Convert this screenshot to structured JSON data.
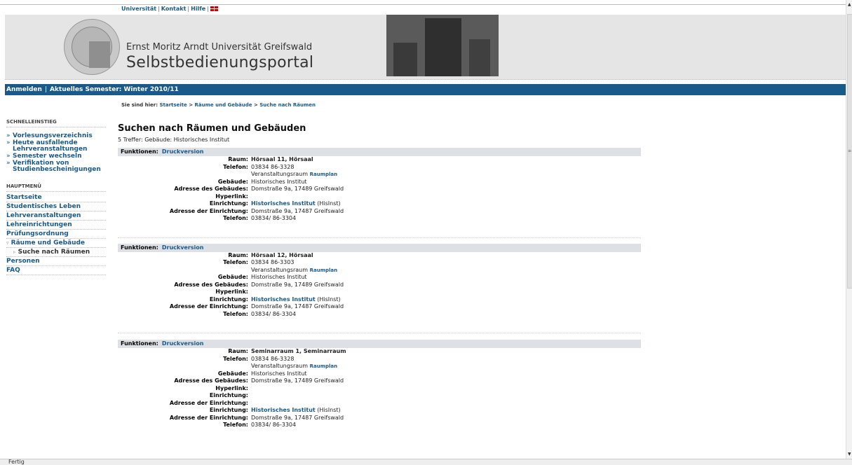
{
  "toplinks": {
    "universitaet": "Universität",
    "kontakt": "Kontakt",
    "hilfe": "Hilfe",
    "sep": "|"
  },
  "header": {
    "university": "Ernst Moritz Arndt Universität Greifswald",
    "portal": "Selbstbedienungsportal"
  },
  "navbar": {
    "login": "Anmelden",
    "semester": "Aktuelles Semester: Winter 2010/11",
    "sep": "|"
  },
  "breadcrumb": {
    "prefix": "Sie sind hier:",
    "crumbs": [
      "Startseite",
      "Räume und Gebäude",
      "Suche nach Räumen"
    ],
    "sep": ">"
  },
  "sidebar": {
    "quick_head": "SCHNELLEINSTIEG",
    "quick": [
      "Vorlesungsverzeichnis",
      "Heute ausfallende Lehrveranstaltungen",
      "Semester wechseln",
      "Verifikation von Studienbescheinigungen"
    ],
    "main_head": "HAUPTMENÜ",
    "main": [
      "Startseite",
      "Studentisches Leben",
      "Lehrveranstaltungen",
      "Lehreinrichtungen",
      "Prüfungsordnung",
      "Räume und Gebäude",
      "Suche nach Räumen",
      "Personen",
      "FAQ"
    ],
    "main_active_marker": "▿",
    "sub_marker": "▹"
  },
  "content": {
    "title": "Suchen nach Räumen und Gebäuden",
    "hits": "5 Treffer: Gebäude: Historisches Institut",
    "func_label": "Funktionen:",
    "func_link": "Druckversion",
    "results": [
      {
        "raum_label": "Raum:",
        "raum": "Hörsaal 11, Hörsaal",
        "telefon_label": "Telefon:",
        "telefon": "03834 86-3328",
        "veranstaltung": "Veranstaltungsraum",
        "raumplan": "Raumplan",
        "gebaeude_label": "Gebäude:",
        "gebaeude": "Historisches Institut",
        "adresse_label": "Adresse des Gebäudes:",
        "adresse": "Domstraße 9a, 17489 Greifswald",
        "hyperlink_label": "Hyperlink:",
        "einrichtung_label": "Einrichtung:",
        "einrichtung": "Historisches Institut",
        "einrichtung_abbr": "(HisInst)",
        "adresse_e_label": "Adresse der Einrichtung:",
        "adresse_e": "Domstraße 9a, 17487 Greifswald",
        "telefon_e": "03834/ 86-3304"
      },
      {
        "raum_label": "Raum:",
        "raum": "Hörsaal 12, Hörsaal",
        "telefon_label": "Telefon:",
        "telefon": "03834 86-3303",
        "veranstaltung": "Veranstaltungsraum",
        "raumplan": "Raumplan",
        "gebaeude_label": "Gebäude:",
        "gebaeude": "Historisches Institut",
        "adresse_label": "Adresse des Gebäudes:",
        "adresse": "Domstraße 9a, 17489 Greifswald",
        "hyperlink_label": "Hyperlink:",
        "einrichtung_label": "Einrichtung:",
        "einrichtung": "Historisches Institut",
        "einrichtung_abbr": "(HisInst)",
        "adresse_e_label": "Adresse der Einrichtung:",
        "adresse_e": "Domstraße 9a, 17487 Greifswald",
        "telefon_e": "03834/ 86-3304"
      },
      {
        "raum_label": "Raum:",
        "raum": "Seminarraum 1, Seminarraum",
        "telefon_label": "Telefon:",
        "telefon": "03834 86-3328",
        "veranstaltung": "Veranstaltungsraum",
        "raumplan": "Raumplan",
        "gebaeude_label": "Gebäude:",
        "gebaeude": "Historisches Institut",
        "adresse_label": "Adresse des Gebäudes:",
        "adresse": "Domstraße 9a, 17489 Greifswald",
        "hyperlink_label": "Hyperlink:",
        "einrichtung_label": "Einrichtung:",
        "adresse_e_label": "Adresse der Einrichtung:",
        "einrichtung2": "Historisches Institut",
        "einrichtung2_abbr": "(HisInst)",
        "adresse_e": "Domstraße 9a, 17487 Greifswald",
        "telefon_e": "03834/ 86-3304"
      }
    ]
  },
  "status": {
    "text": "Fertig"
  },
  "colors": {
    "accent": "#1a5a8a",
    "header_bg": "#e5e5e5",
    "func_bg": "#dde0e4"
  }
}
